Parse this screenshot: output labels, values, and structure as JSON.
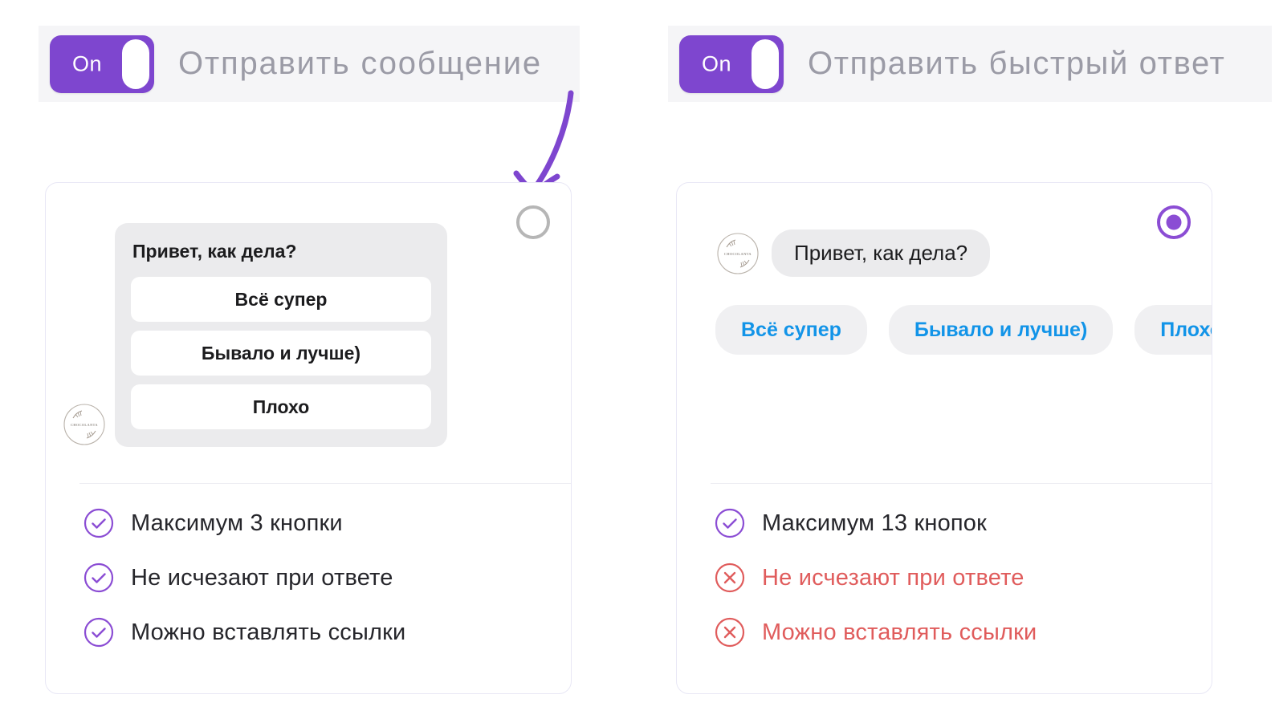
{
  "colors": {
    "purple": "#7e46cf",
    "purple_radio": "#8b4dd4",
    "chip_blue": "#1294e8",
    "negative_red": "#e05c5c",
    "header_band": "#f5f5f7",
    "bubble_gray": "#ebebed",
    "card_border": "#e8e7f5"
  },
  "panels": [
    {
      "id": "send-message",
      "header": {
        "toggle_label": "On",
        "toggle_state": "on",
        "title": "Отправить сообщение"
      },
      "radio": {
        "selected": false
      },
      "preview": {
        "type": "button-template",
        "avatar_icon": "chocolanta-logo-avatar",
        "message": "Привет, как дела?",
        "buttons": [
          "Всё супер",
          "Бывало и лучше)",
          "Плохо"
        ]
      },
      "features": [
        {
          "icon": "check-circle-icon",
          "status": "positive",
          "text": "Максимум 3 кнопки"
        },
        {
          "icon": "check-circle-icon",
          "status": "positive",
          "text": "Не исчезают при ответе"
        },
        {
          "icon": "check-circle-icon",
          "status": "positive",
          "text": "Можно вставлять ссылки"
        }
      ]
    },
    {
      "id": "send-quick-reply",
      "header": {
        "toggle_label": "On",
        "toggle_state": "on",
        "title": "Отправить быстрый ответ"
      },
      "radio": {
        "selected": true
      },
      "preview": {
        "type": "quick-reply",
        "avatar_icon": "chocolanta-logo-avatar",
        "message": "Привет, как дела?",
        "chips": [
          "Всё супер",
          "Бывало и лучше)",
          "Плохо"
        ]
      },
      "features": [
        {
          "icon": "check-circle-icon",
          "status": "positive",
          "text": "Максимум 13 кнопок"
        },
        {
          "icon": "x-circle-icon",
          "status": "negative",
          "text": "Не исчезают при ответе"
        },
        {
          "icon": "x-circle-icon",
          "status": "negative",
          "text": "Можно вставлять ссылки"
        }
      ]
    }
  ]
}
